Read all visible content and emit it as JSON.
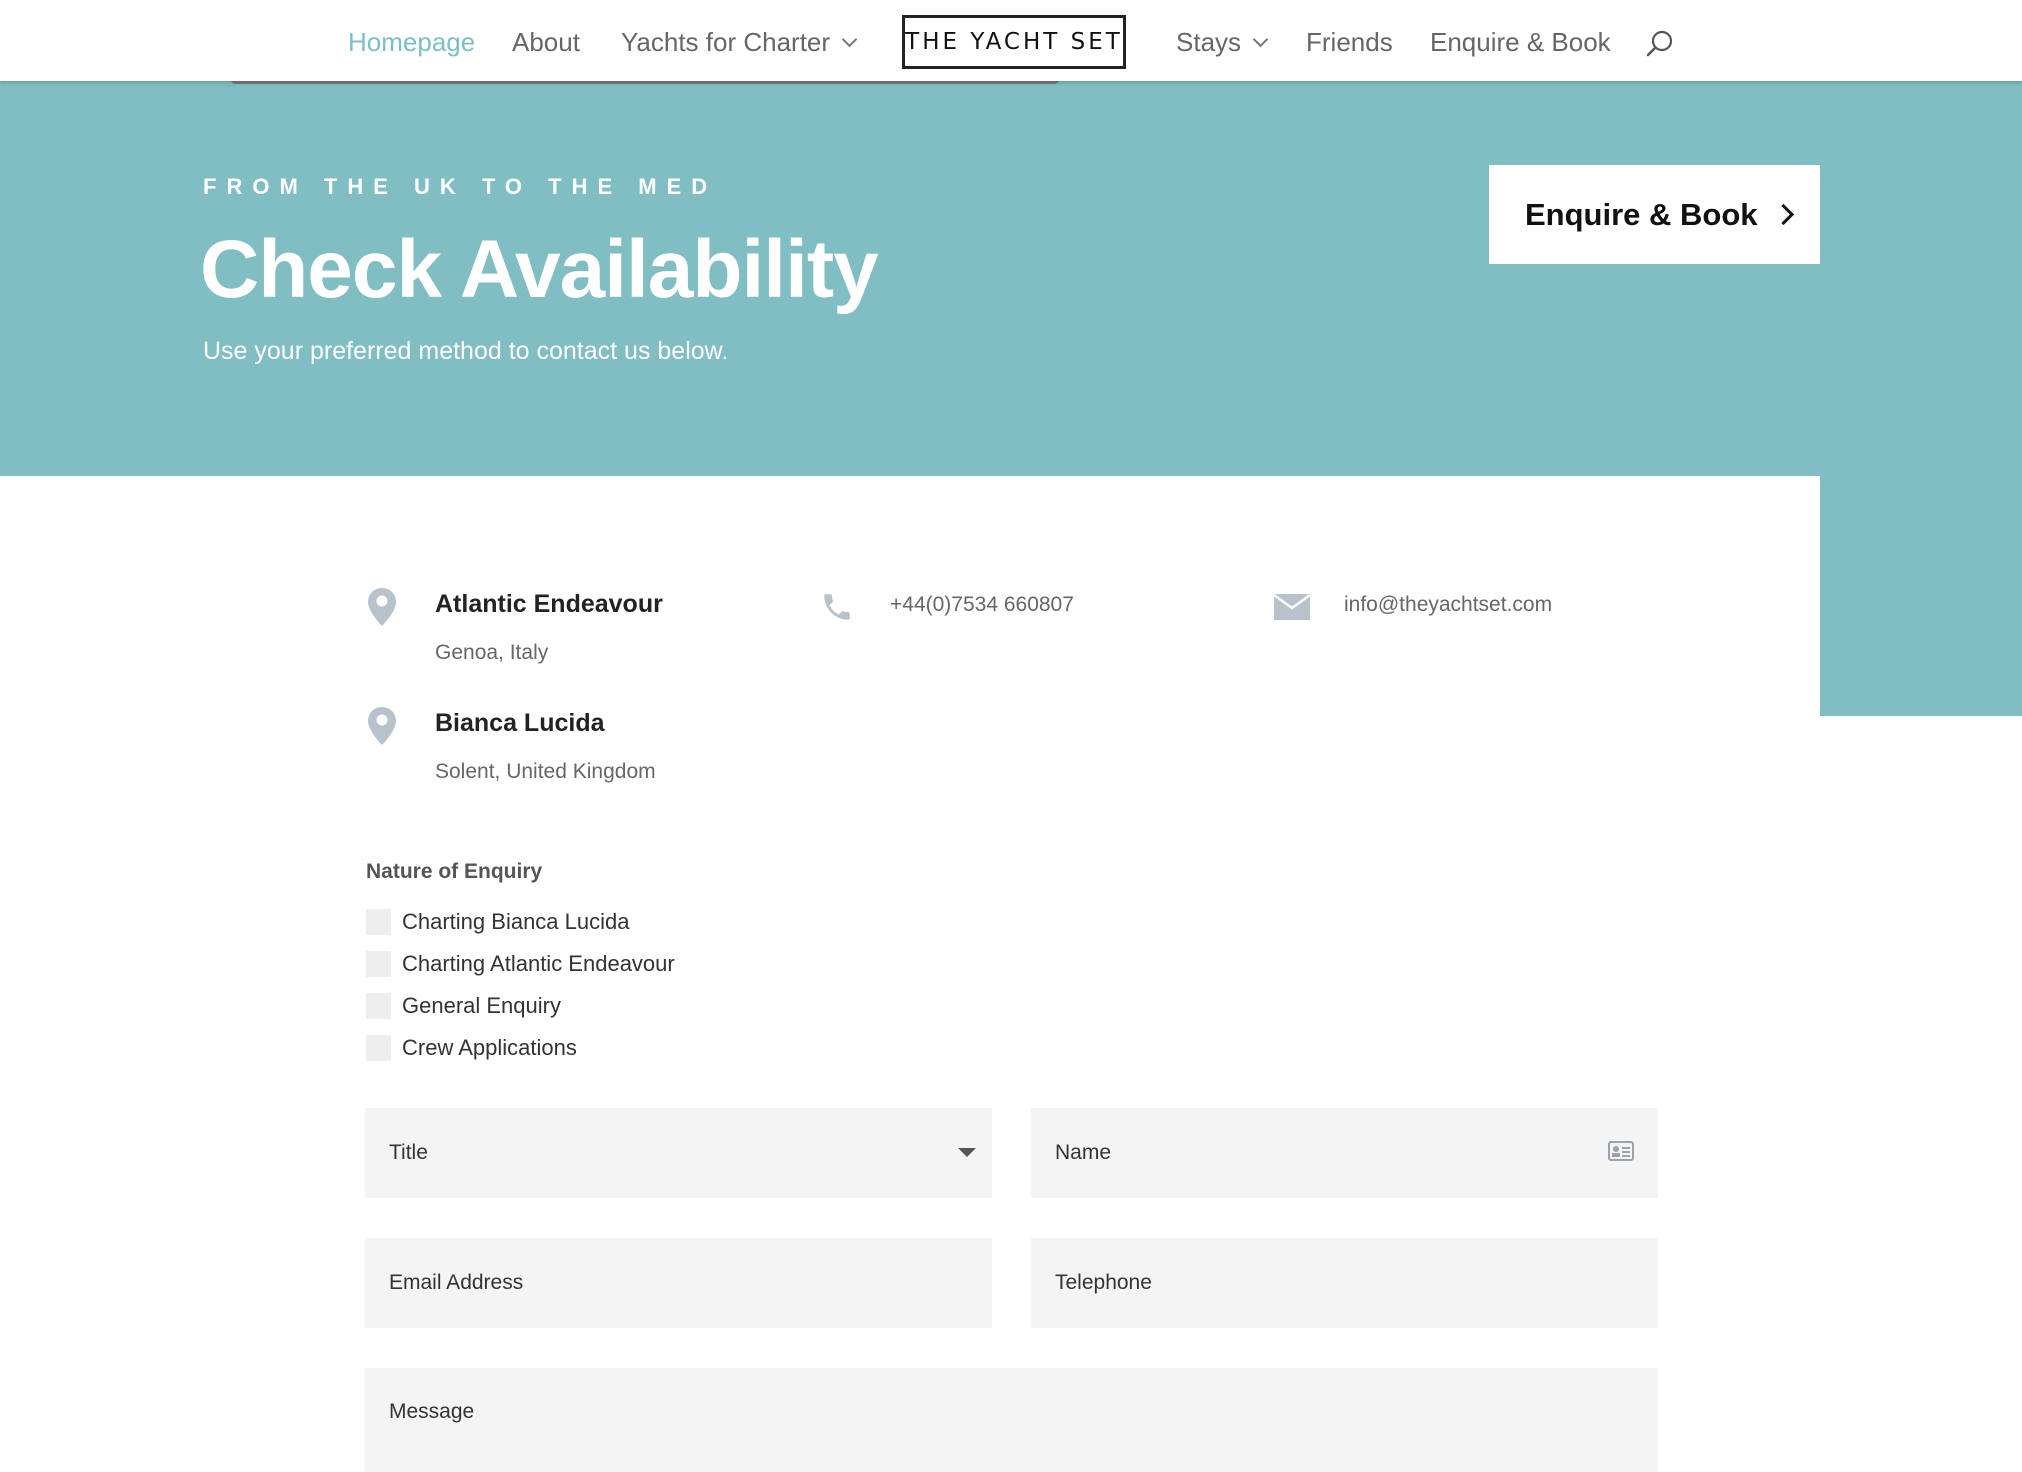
{
  "nav": {
    "left_items": [
      {
        "label": "Homepage",
        "active": true
      },
      {
        "label": "About"
      },
      {
        "label": "Yachts for Charter",
        "has_dropdown": true
      }
    ],
    "logo": "THE YACHT SET",
    "right_items": [
      {
        "label": "Stays",
        "has_dropdown": true
      },
      {
        "label": "Friends"
      },
      {
        "label": "Enquire & Book"
      }
    ],
    "search_icon": "search-icon"
  },
  "hero": {
    "eyebrow": "FROM THE UK TO THE MED",
    "title": "Check Availability",
    "subtitle": "Use your preferred method to contact us below.",
    "cta_label": "Enquire & Book",
    "background_color": "#80bec4"
  },
  "contacts": {
    "locations": [
      {
        "name": "Atlantic Endeavour",
        "place": "Genoa, Italy"
      },
      {
        "name": "Bianca Lucida",
        "place": "Solent, United Kingdom"
      }
    ],
    "phone": "+44(0)7534 660807",
    "email": "info@theyachtset.com"
  },
  "form": {
    "enquiry_label": "Nature of Enquiry",
    "options": [
      {
        "label": "Charting Bianca Lucida",
        "checked": false
      },
      {
        "label": "Charting Atlantic Endeavour",
        "checked": false
      },
      {
        "label": "General Enquiry",
        "checked": false
      },
      {
        "label": "Crew Applications",
        "checked": false
      }
    ],
    "title_placeholder": "Title",
    "name_placeholder": "Name",
    "email_placeholder": "Email Address",
    "telephone_placeholder": "Telephone",
    "message_placeholder": "Message"
  },
  "colors": {
    "accent": "#7ebec4",
    "field_bg": "#f4f4f4",
    "icon_grey": "#b8c2cc"
  }
}
